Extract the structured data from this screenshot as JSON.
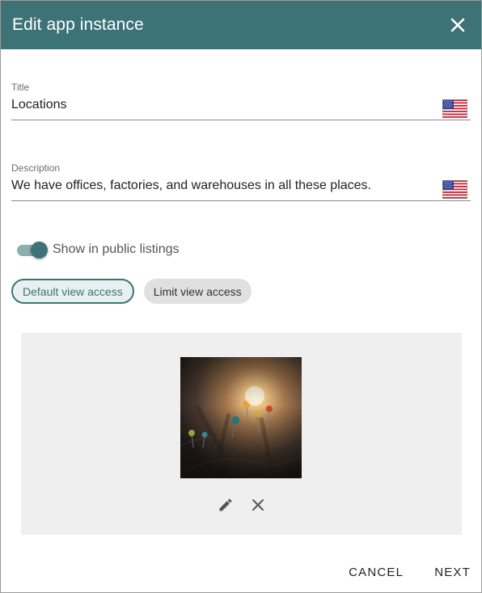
{
  "dialog": {
    "title": "Edit app instance",
    "close_icon": "close-icon"
  },
  "fields": {
    "title": {
      "label": "Title",
      "value": "Locations",
      "language_icon": "us-flag-icon"
    },
    "description": {
      "label": "Description",
      "value": "We have offices, factories, and warehouses in all these places.",
      "language_icon": "us-flag-icon"
    }
  },
  "toggle": {
    "label": "Show in public listings",
    "checked": true
  },
  "access": {
    "default_label": "Default view access",
    "limit_label": "Limit view access",
    "selected": "default"
  },
  "image": {
    "edit_icon": "pencil-icon",
    "remove_icon": "close-icon"
  },
  "actions": {
    "cancel_label": "CANCEL",
    "next_label": "NEXT"
  },
  "colors": {
    "accent": "#3d7377",
    "panel": "#efefef",
    "chip_filled": "#e0e0e0"
  }
}
